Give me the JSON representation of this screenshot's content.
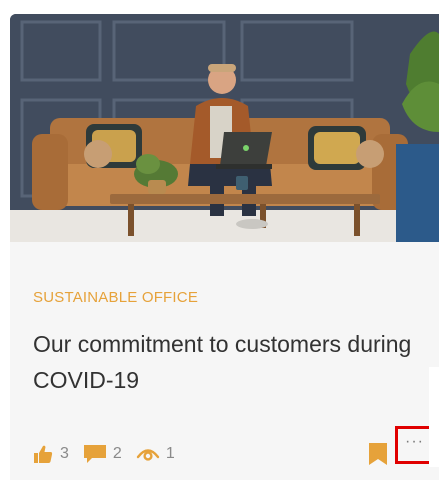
{
  "card": {
    "category": "SUSTAINABLE OFFICE",
    "title": "Our commitment to customers during COVID-19",
    "stats": {
      "likes": "3",
      "comments": "2",
      "views": "1"
    },
    "more_label": "···"
  },
  "icons": {
    "like": "thumbs-up-icon",
    "comment": "comment-icon",
    "view": "eye-icon",
    "bookmark": "bookmark-icon",
    "more": "more-options-icon"
  },
  "colors": {
    "accent": "#e6a23a",
    "title": "#323232",
    "muted": "#8a8a8a",
    "highlight_border": "#e00000",
    "card_bg": "#f6f6f6"
  }
}
